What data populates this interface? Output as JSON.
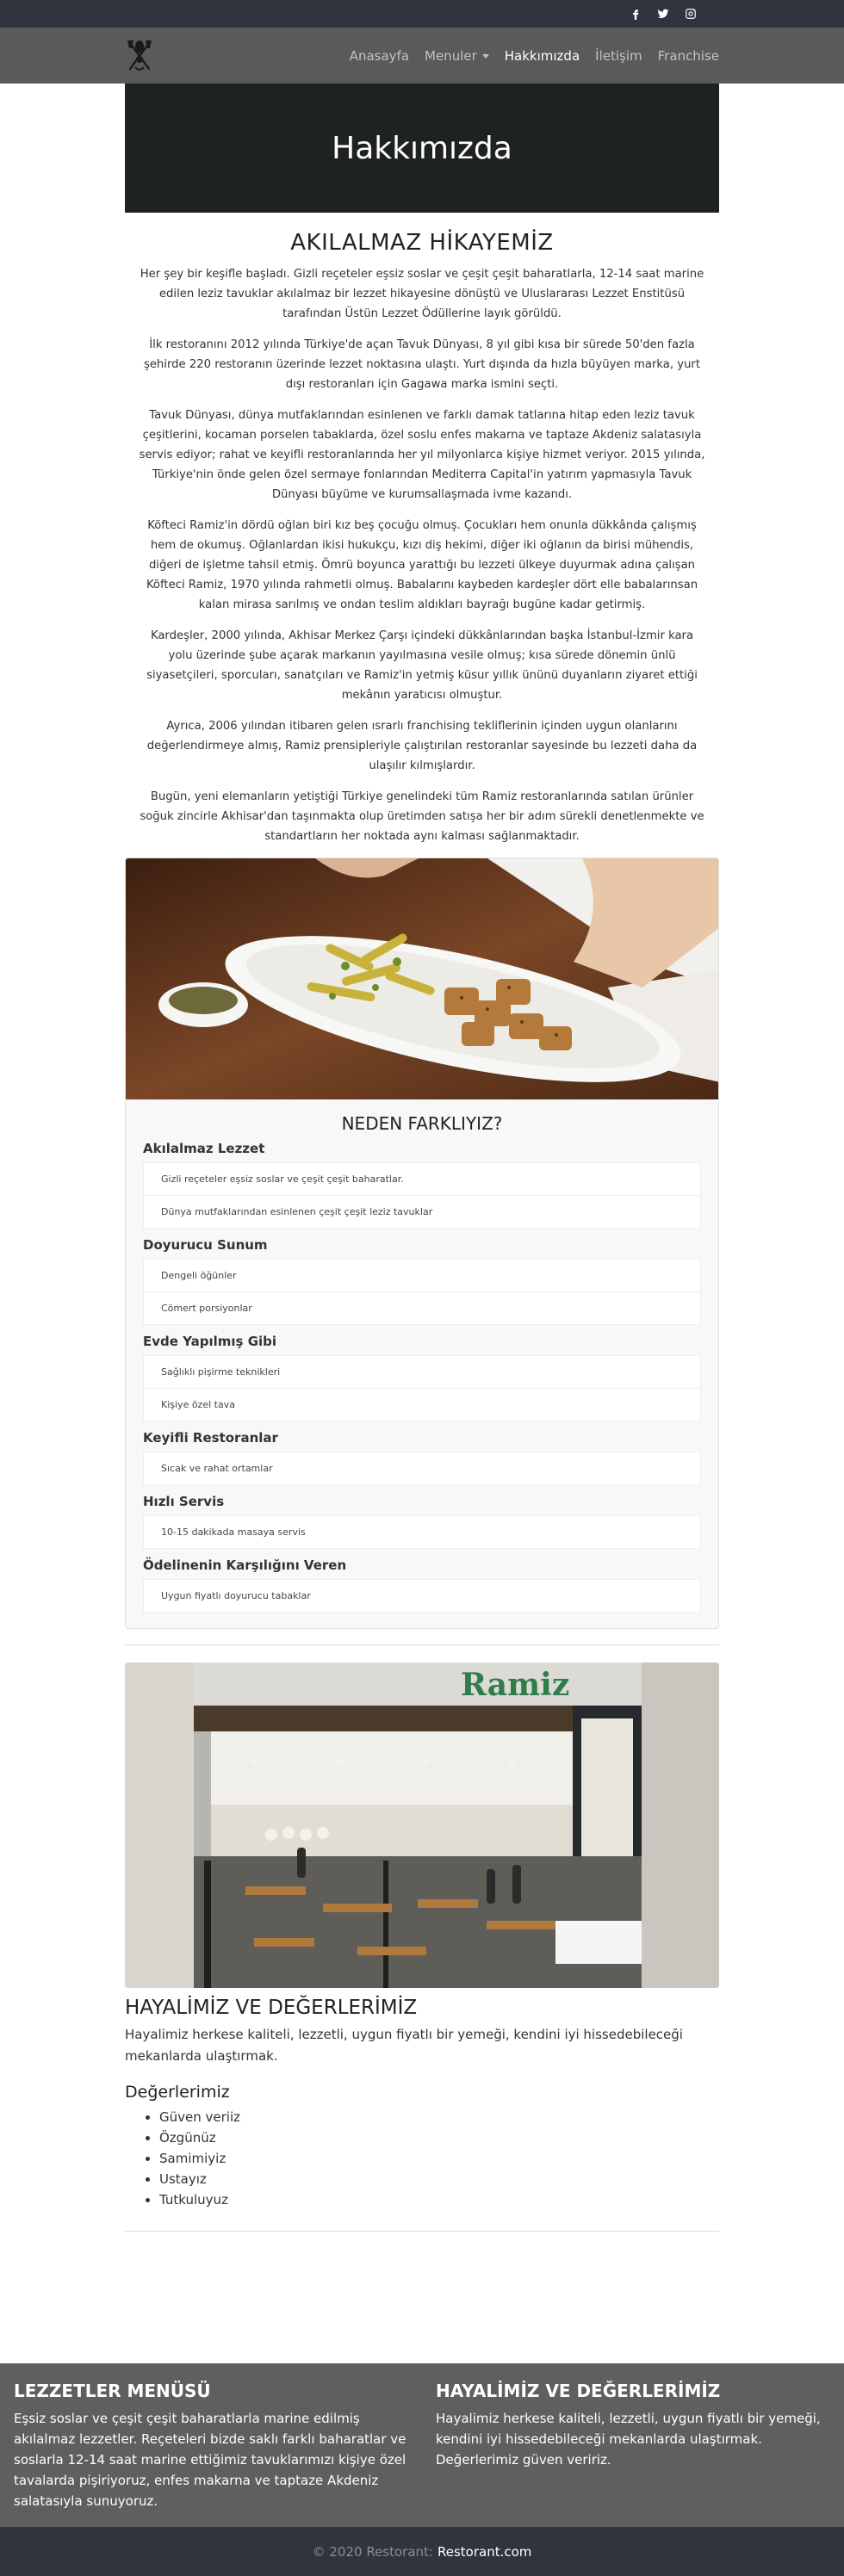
{
  "social": {
    "facebook": "facebook-icon",
    "twitter": "twitter-icon",
    "instagram": "instagram-icon"
  },
  "nav": {
    "items": [
      "Anasayfa",
      "Menuler",
      "Hakkımızda",
      "İletişim",
      "Franchise"
    ],
    "active": "Hakkımızda"
  },
  "hero": {
    "title": "Hakkımızda"
  },
  "story": {
    "title": "AKILALMAZ HİKAYEMİZ",
    "paragraphs": [
      "Her şey bir keşifle başladı. Gizli reçeteler eşsiz soslar ve çeşit çeşit baharatlarla, 12-14 saat marine edilen leziz tavuklar akılalmaz bir lezzet hikayesine dönüştü ve Uluslararası Lezzet Enstitüsü tarafından Üstün Lezzet Ödüllerine layık görüldü.",
      "İlk restoranını 2012 yılında Türkiye'de açan Tavuk Dünyası, 8 yıl gibi kısa bir sürede 50'den fazla şehirde 220 restoranın üzerinde lezzet noktasına ulaştı. Yurt dışında da hızla büyüyen marka, yurt dışı restoranları için Gagawa marka ismini seçti.",
      "Tavuk Dünyası, dünya mutfaklarından esinlenen ve farklı damak tatlarına hitap eden leziz tavuk çeşitlerini, kocaman porselen tabaklarda, özel soslu enfes makarna ve taptaze Akdeniz salatasıyla servis ediyor; rahat ve keyifli restoranlarında her yıl milyonlarca kişiye hizmet veriyor. 2015 yılında, Türkiye'nin önde gelen özel sermaye fonlarından Mediterra Capital'in yatırım yapmasıyla Tavuk Dünyası büyüme ve kurumsallaşmada ivme kazandı.",
      "Köfteci Ramiz'in dördü oğlan biri kız beş çocuğu olmuş. Çocukları hem onunla dükkânda çalışmış hem de okumuş. Oğlanlardan ikisi hukukçu, kızı diş hekimi, diğer iki oğlanın da birisi mühendis, diğeri de işletme tahsil etmiş. Ömrü boyunca yarattığı bu lezzeti ülkeye duyurmak adına çalışan Köfteci Ramiz, 1970 yılında rahmetli olmuş. Babalarını kaybeden kardeşler dört elle babalarınsan kalan mirasa sarılmış ve ondan teslim aldıkları bayrağı bugüne kadar getirmiş.",
      "Kardeşler, 2000 yılında, Akhisar Merkez Çarşı içindeki dükkânlarından başka İstanbul-İzmir kara yolu üzerinde şube açarak markanın yayılmasına vesile olmuş; kısa sürede dönemin ünlü siyasetçileri, sporcuları, sanatçıları ve Ramiz'in yetmiş küsur yıllık ününü duyanların ziyaret ettiği mekânın yaratıcısı olmuştur.",
      "Ayrıca, 2006 yılından itibaren gelen ısrarlı franchising tekliflerinin içinden uygun olanlarını değerlendirmeye almış, Ramiz prensipleriyle çalıştırılan restoranlar sayesinde bu lezzeti daha da ulaşılır kılmışlardır.",
      "Bugün, yeni elemanların yetiştiği Türkiye genelindeki tüm Ramiz restoranlarında satılan ürünler soğuk zincirle Akhisar'dan taşınmakta olup üretimden satışa her bir adım sürekli denetlenmekte ve standartların her noktada aynı kalması sağlanmaktadır."
    ]
  },
  "why": {
    "title": "NEDEN FARKLIYIZ?",
    "groups": [
      {
        "title": "Akılalmaz Lezzet",
        "items": [
          "Gizli reçeteler eşsiz soslar ve çeşit çeşit baharatlar.",
          "Dünya mutfaklarından esinlenen çeşit çeşit leziz tavuklar"
        ]
      },
      {
        "title": "Doyurucu Sunum",
        "items": [
          "Dengeli öğünler",
          "Cömert porsiyonlar"
        ]
      },
      {
        "title": "Evde Yapılmış Gibi",
        "items": [
          "Sağlıklı pişirme teknikleri",
          "Kişiye özel tava"
        ]
      },
      {
        "title": "Keyifli Restoranlar",
        "items": [
          "Sıcak ve rahat ortamlar"
        ]
      },
      {
        "title": "Hızlı Servis",
        "items": [
          "10-15 dakikada masaya servis"
        ]
      },
      {
        "title": "Ödelinenin Karşılığını Veren",
        "items": [
          "Uygun fiyatlı doyurucu tabaklar"
        ]
      }
    ]
  },
  "restaurant_sign": "Ramiz",
  "values": {
    "title": "HAYALİMİZ VE DEĞERLERİMİZ",
    "text": "Hayalimiz herkese kaliteli, lezzetli, uygun fiyatlı bir yemeği, kendini iyi hissedebileceği mekanlarda ulaştırmak.",
    "subtitle": "Değerlerimiz",
    "list": [
      "Güven veriiz",
      "Özgünüz",
      "Samimiyiz",
      "Ustayız",
      "Tutkuluyuz"
    ]
  },
  "footer": {
    "left_title": "LEZZETLER MENÜSÜ",
    "left_text": "Eşsiz soslar ve çeşit çeşit baharatlarla marine edilmiş akılalmaz lezzetler. Reçeteleri bizde saklı farklı baharatlar ve soslarla 12-14 saat marine ettiğimiz tavuklarımızı kişiye özel tavalarda pişiriyoruz, enfes makarna ve taptaze Akdeniz salatasıyla sunuyoruz.",
    "right_title": "HAYALİMİZ VE DEĞERLERİMİZ",
    "right_text": "Hayalimiz herkese kaliteli, lezzetli, uygun fiyatlı bir yemeği, kendini iyi hissedebileceği mekanlarda ulaştırmak. Değerlerimiz güven veririz."
  },
  "copyright": {
    "text": "© 2020 Restorant:",
    "link": "Restorant.com"
  }
}
